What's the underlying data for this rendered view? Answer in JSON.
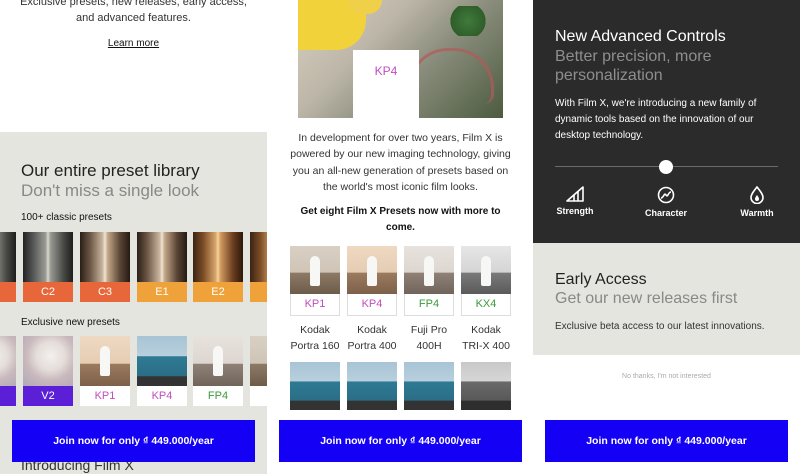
{
  "panel1": {
    "intro_text": "Exclusive presets, new releases, early access, and advanced features.",
    "learn_more": "Learn more",
    "library_title": "Our entire preset library",
    "library_subtitle": "Don't miss a single look",
    "classic_label": "100+ classic presets",
    "classic_tiles": [
      {
        "label": "",
        "color": "#e8673a"
      },
      {
        "label": "C2",
        "color": "#e8673a"
      },
      {
        "label": "C3",
        "color": "#e8673a"
      },
      {
        "label": "E1",
        "color": "#f0a23a"
      },
      {
        "label": "E2",
        "color": "#f0a23a"
      },
      {
        "label": "",
        "color": "#f0a23a"
      }
    ],
    "exclusive_label": "Exclusive new presets",
    "exclusive_tiles": [
      {
        "label": "",
        "color": "#5a1fd6"
      },
      {
        "label": "V2",
        "color": "#5a1fd6"
      },
      {
        "label": "KP1",
        "color": "#c24cc0"
      },
      {
        "label": "KP4",
        "color": "#c24cc0"
      },
      {
        "label": "FP4",
        "color": "#3a9a3a"
      }
    ],
    "bottom_heading": "Introducing Film X"
  },
  "panel2": {
    "hero_label": "KP4",
    "description": "In development for over two years, Film X is powered by our new imaging technology, giving you an all-new generation of presets based on the world's most iconic film looks.",
    "cta_text": "Get eight Film X Presets now with more to come.",
    "films_row1": [
      {
        "code": "KP1",
        "code_color": "#c24cc0",
        "name_line1": "Kodak",
        "name_line2": "Portra 160"
      },
      {
        "code": "KP4",
        "code_color": "#c24cc0",
        "name_line1": "Kodak",
        "name_line2": "Portra 400"
      },
      {
        "code": "FP4",
        "code_color": "#3a9a3a",
        "name_line1": "Fuji Pro",
        "name_line2": "400H"
      },
      {
        "code": "KX4",
        "code_color": "#3a9a3a",
        "name_line1": "Kodak",
        "name_line2": "TRI-X 400"
      }
    ]
  },
  "panel3": {
    "advanced_title": "New Advanced Controls",
    "advanced_subtitle": "Better precision, more personalization",
    "advanced_desc": "With Film X, we're introducing a new family of dynamic tools based on the innovation of our desktop technology.",
    "controls": [
      {
        "label": "Strength",
        "icon": "strength-icon"
      },
      {
        "label": "Character",
        "icon": "character-icon"
      },
      {
        "label": "Warmth",
        "icon": "warmth-icon"
      }
    ],
    "early_title": "Early Access",
    "early_subtitle": "Get our new releases first",
    "early_desc": "Exclusive beta access to our latest innovations.",
    "no_thanks": "No thanks, I'm not interested"
  },
  "join_button": "Join now for only ₫ 449.000/year",
  "colors": {
    "accent_blue": "#1400f5",
    "panel_grey": "#e5e5df",
    "dark_panel": "#2b2b2b"
  }
}
